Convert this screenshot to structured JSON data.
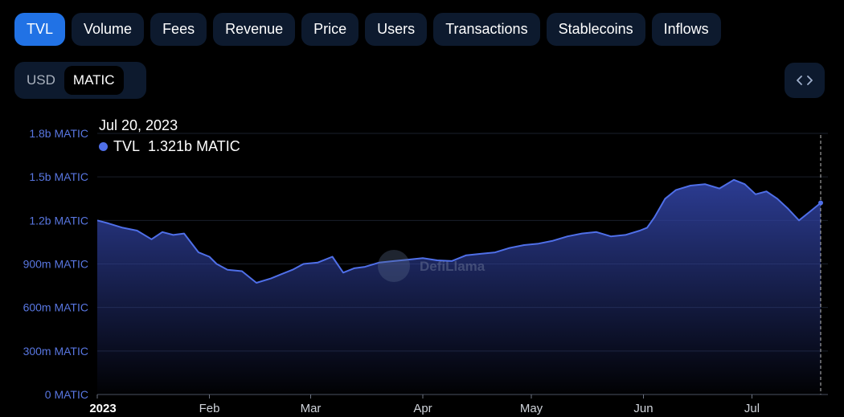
{
  "tabs": [
    "TVL",
    "Volume",
    "Fees",
    "Revenue",
    "Price",
    "Users",
    "Transactions",
    "Stablecoins",
    "Inflows"
  ],
  "active_tab": "TVL",
  "currency_toggle": {
    "options": [
      "USD",
      "MATIC"
    ],
    "active": "MATIC"
  },
  "embed_icon": "code-brackets-icon",
  "watermark": "DefiLlama",
  "tooltip": {
    "date": "Jul 20, 2023",
    "series": "TVL",
    "value": "1.321b MATIC"
  },
  "colors": {
    "accent": "#2172e5",
    "line": "#4f6fe8",
    "fill_top": "#2e3f9a",
    "panel": "#0d1a2e",
    "axis_label": "#5876e0"
  },
  "chart_data": {
    "type": "area",
    "series": [
      {
        "name": "TVL",
        "x": [
          "2023-01-01",
          "2023-01-04",
          "2023-01-08",
          "2023-01-12",
          "2023-01-16",
          "2023-01-19",
          "2023-01-22",
          "2023-01-25",
          "2023-01-29",
          "2023-02-01",
          "2023-02-03",
          "2023-02-06",
          "2023-02-10",
          "2023-02-14",
          "2023-02-18",
          "2023-02-21",
          "2023-02-24",
          "2023-02-27",
          "2023-03-03",
          "2023-03-07",
          "2023-03-10",
          "2023-03-13",
          "2023-03-16",
          "2023-03-20",
          "2023-03-24",
          "2023-03-28",
          "2023-04-01",
          "2023-04-05",
          "2023-04-09",
          "2023-04-13",
          "2023-04-17",
          "2023-04-21",
          "2023-04-25",
          "2023-04-29",
          "2023-05-03",
          "2023-05-07",
          "2023-05-11",
          "2023-05-15",
          "2023-05-19",
          "2023-05-23",
          "2023-05-27",
          "2023-05-31",
          "2023-06-02",
          "2023-06-04",
          "2023-06-07",
          "2023-06-10",
          "2023-06-14",
          "2023-06-18",
          "2023-06-22",
          "2023-06-26",
          "2023-06-29",
          "2023-07-02",
          "2023-07-05",
          "2023-07-08",
          "2023-07-11",
          "2023-07-14",
          "2023-07-17",
          "2023-07-20"
        ],
        "values": [
          1200,
          1180,
          1150,
          1130,
          1070,
          1120,
          1100,
          1110,
          980,
          950,
          900,
          860,
          850,
          770,
          800,
          830,
          860,
          900,
          910,
          950,
          840,
          870,
          880,
          910,
          920,
          930,
          940,
          925,
          920,
          960,
          970,
          980,
          1010,
          1030,
          1040,
          1060,
          1090,
          1110,
          1120,
          1090,
          1100,
          1130,
          1150,
          1220,
          1350,
          1410,
          1440,
          1450,
          1420,
          1480,
          1450,
          1380,
          1400,
          1350,
          1280,
          1200,
          1260,
          1321
        ]
      }
    ],
    "y_ticks": [
      "0 MATIC",
      "300m MATIC",
      "600m MATIC",
      "900m MATIC",
      "1.2b MATIC",
      "1.5b MATIC",
      "1.8b MATIC"
    ],
    "ylim": [
      0,
      1800
    ],
    "y_unit": "millions of MATIC",
    "x_ticks": [
      {
        "label": "2023",
        "date": "2023-01-01"
      },
      {
        "label": "Feb",
        "date": "2023-02-01"
      },
      {
        "label": "Mar",
        "date": "2023-03-01"
      },
      {
        "label": "Apr",
        "date": "2023-04-01"
      },
      {
        "label": "May",
        "date": "2023-05-01"
      },
      {
        "label": "Jun",
        "date": "2023-06-01"
      },
      {
        "label": "Jul",
        "date": "2023-07-01"
      }
    ],
    "grid": "horizontal",
    "legend": "top-left tooltip"
  }
}
